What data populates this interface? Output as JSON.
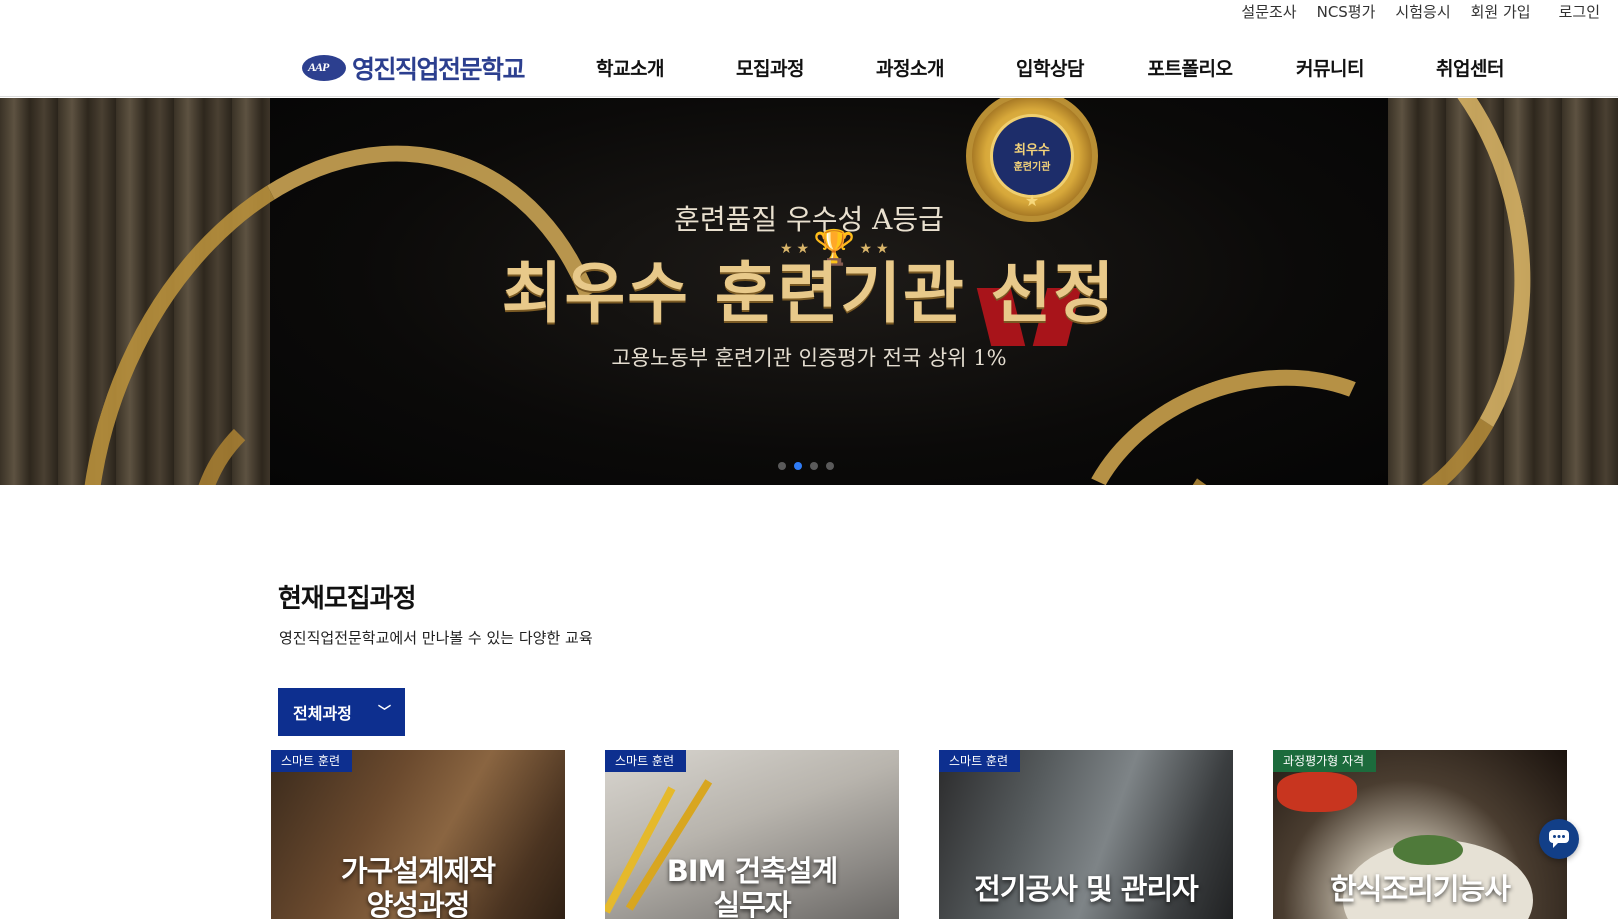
{
  "util_links": [
    "설문조사",
    "NCS평가",
    "시험응시",
    "회원 가입",
    "로그인"
  ],
  "logo": {
    "mark": "AAP",
    "text": "영진직업전문학교"
  },
  "nav": [
    "학교소개",
    "모집과정",
    "과정소개",
    "입학상담",
    "포트폴리오",
    "커뮤니티",
    "취업센터"
  ],
  "hero": {
    "medal_line1": "최우수",
    "medal_line2": "훈련기관",
    "subtitle": "훈련품질 우수성 A등급",
    "title": "최우수 훈련기관 선정",
    "description": "고용노동부 훈련기관 인증평가 전국 상위 1%",
    "slide_count": 4,
    "active_slide": 2
  },
  "section": {
    "title": "현재모집과정",
    "subtitle": "영진직업전문학교에서 만나볼 수 있는 다양한 교육",
    "filter_label": "전체과정"
  },
  "cards": [
    {
      "tag": "스마트 훈련",
      "title_line1": "가구설계제작",
      "title_line2": "양성과정"
    },
    {
      "tag": "스마트 훈련",
      "title_line1": "BIM 건축설계",
      "title_line2": "실무자"
    },
    {
      "tag": "스마트 훈련",
      "title_line1": "전기공사 및 관리자",
      "title_line2": ""
    },
    {
      "tag": "과정평가형 자격",
      "title_line1": "한식조리기능사",
      "title_line2": ""
    }
  ],
  "colors": {
    "brand": "#2c3f8f",
    "filter": "#0d2f8f",
    "active_dot": "#2f7cf6",
    "gold": "#e8c98a"
  },
  "icons": {
    "chat": "chat-bubble-icon",
    "filter": "chevron-down-icon"
  }
}
